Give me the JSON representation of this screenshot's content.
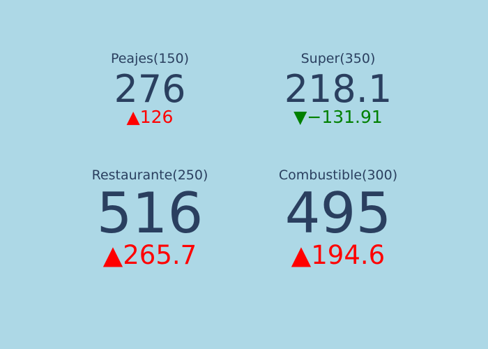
{
  "colors": {
    "background": "#add8e6",
    "text": "#2a3f5f",
    "increase": "#ff0000",
    "decrease": "#008000"
  },
  "indicators": [
    {
      "title": "Peajes(150)",
      "value": "276",
      "delta": "126",
      "direction": "up",
      "arrow_icon": "triangle-up-icon",
      "arrow": "▲"
    },
    {
      "title": "Super(350)",
      "value": "218.1",
      "delta": "−131.91",
      "direction": "down",
      "arrow_icon": "triangle-down-icon",
      "arrow": "▼"
    },
    {
      "title": "Restaurante(250)",
      "value": "516",
      "delta": "265.7",
      "direction": "up",
      "arrow_icon": "triangle-up-icon",
      "arrow": "▲"
    },
    {
      "title": "Combustible(300)",
      "value": "495",
      "delta": "194.6",
      "direction": "up",
      "arrow_icon": "triangle-up-icon",
      "arrow": "▲"
    }
  ]
}
